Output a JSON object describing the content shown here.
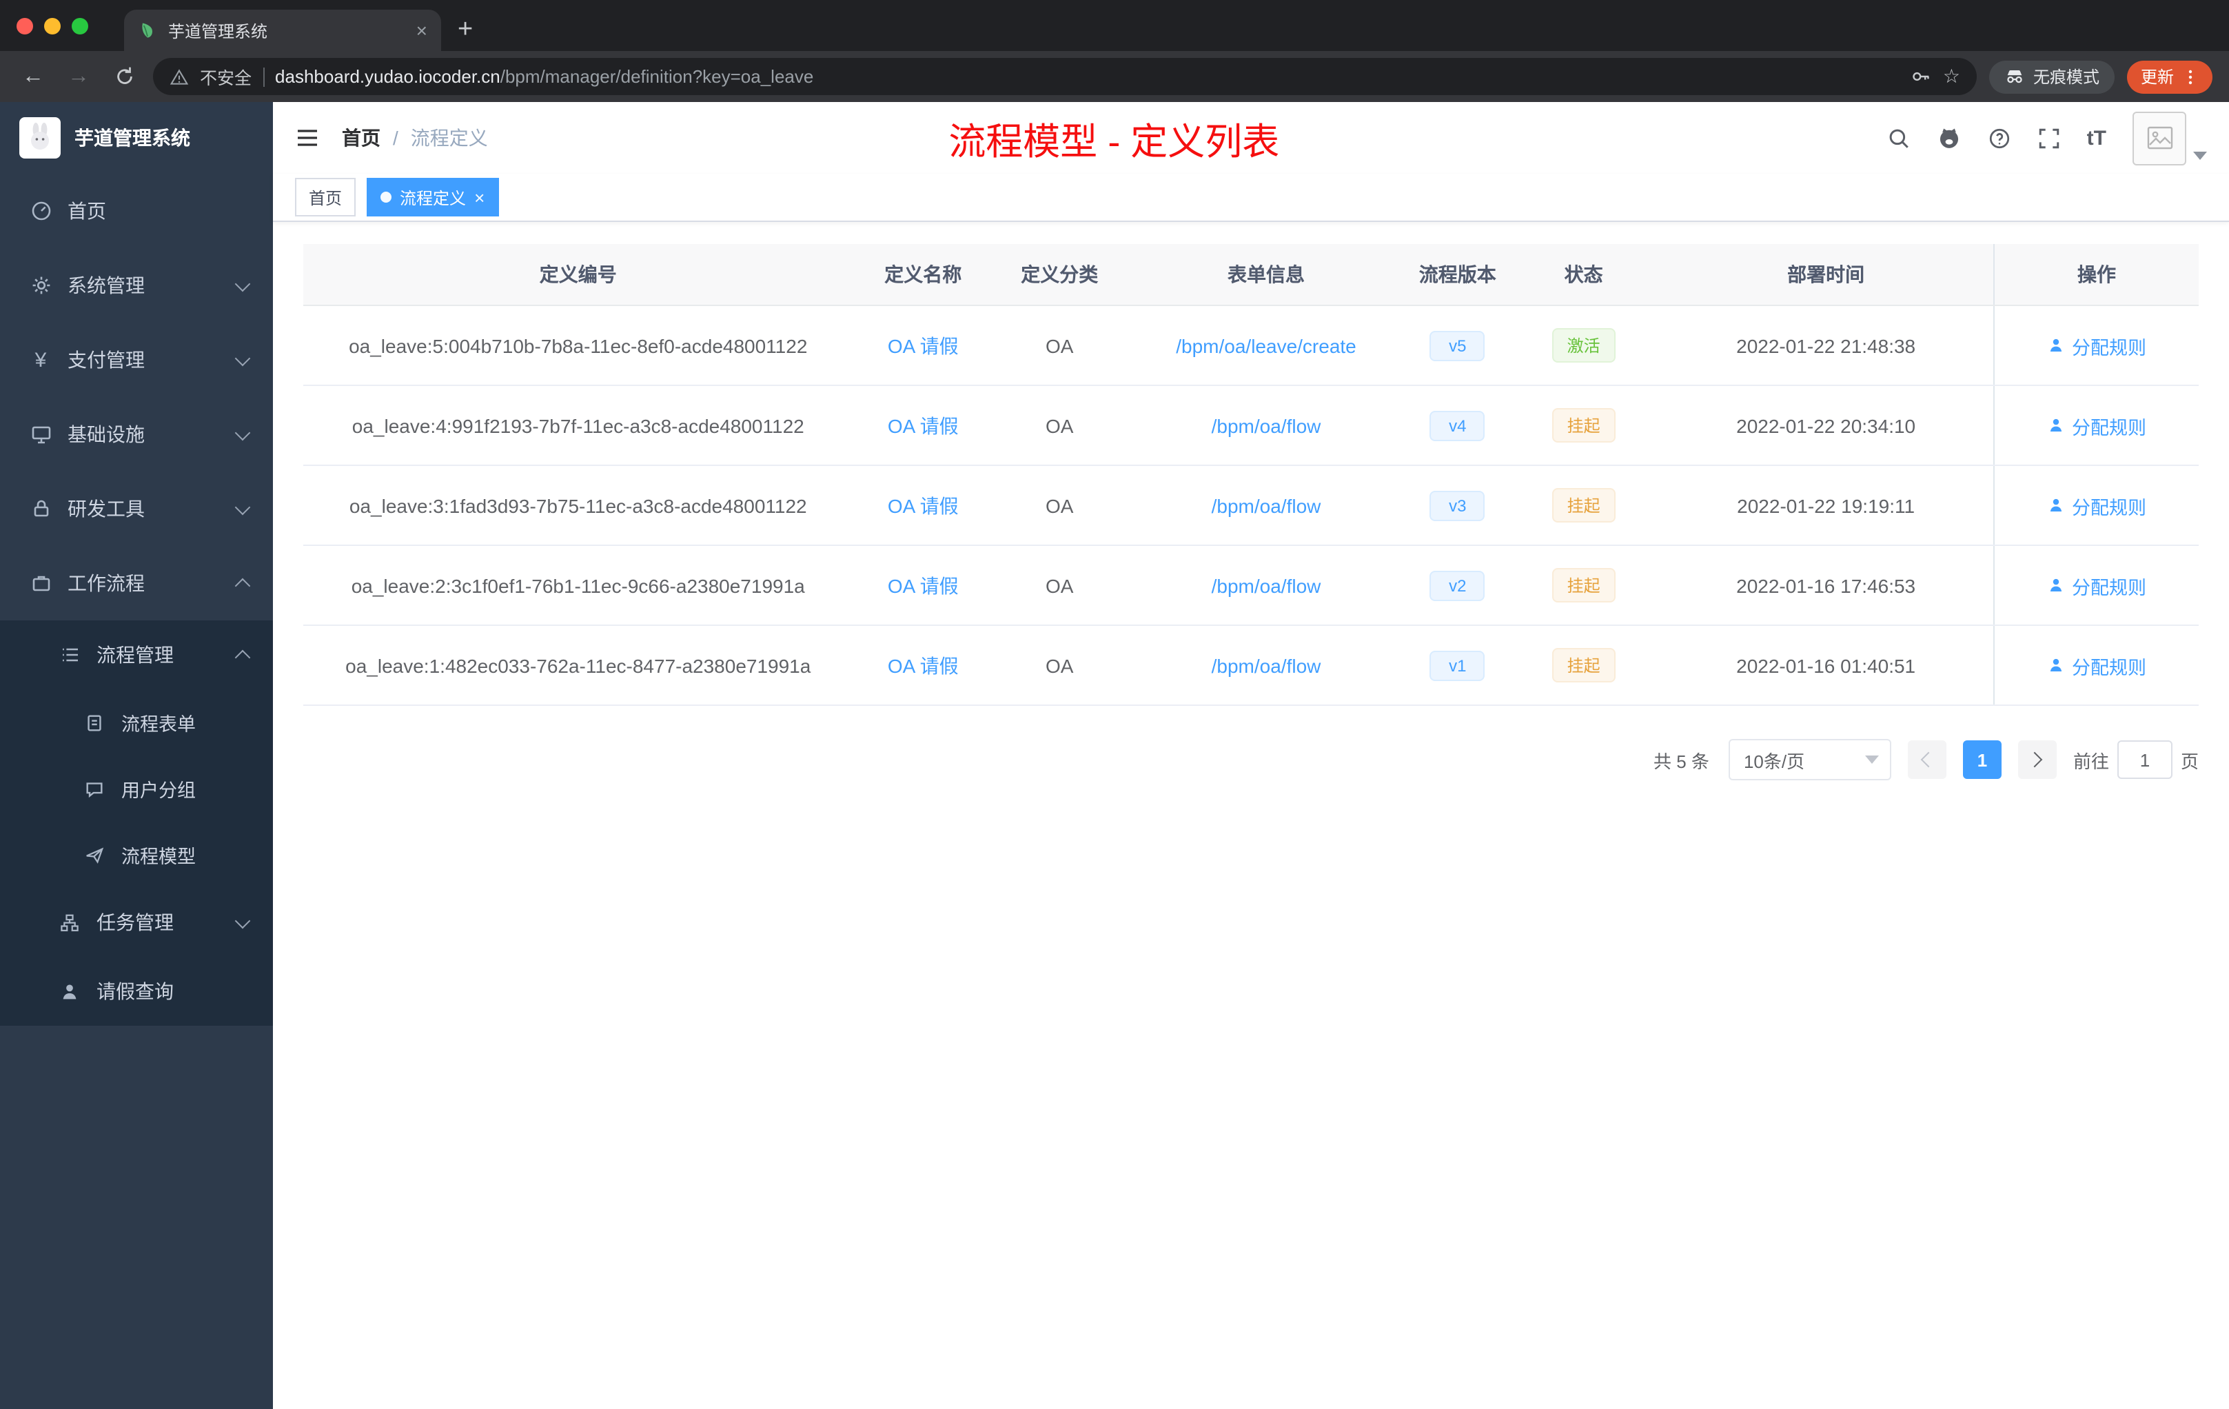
{
  "browser": {
    "tab_title": "芋道管理系统",
    "security_label": "不安全",
    "url_host": "dashboard.yudao.iocoder.cn",
    "url_path": "/bpm/manager/definition?key=oa_leave",
    "incognito_label": "无痕模式",
    "update_label": "更新"
  },
  "sidebar": {
    "logo_title": "芋道管理系统",
    "items": {
      "home": "首页",
      "system": "系统管理",
      "payment": "支付管理",
      "infra": "基础设施",
      "dev_tools": "研发工具",
      "workflow": "工作流程",
      "process_mgmt": "流程管理",
      "process_form": "流程表单",
      "user_group": "用户分组",
      "process_model": "流程模型",
      "task_mgmt": "任务管理",
      "leave_query": "请假查询"
    }
  },
  "header": {
    "breadcrumb_home": "首页",
    "breadcrumb_separator": "/",
    "breadcrumb_current": "流程定义",
    "annotation": "流程模型 - 定义列表",
    "fontsize_glyph": "tT"
  },
  "tags": {
    "home": "首页",
    "active": "流程定义"
  },
  "table": {
    "columns": [
      "定义编号",
      "定义名称",
      "定义分类",
      "表单信息",
      "流程版本",
      "状态",
      "部署时间",
      "操作"
    ],
    "rows": [
      {
        "id": "oa_leave:5:004b710b-7b8a-11ec-8ef0-acde48001122",
        "name": "OA 请假",
        "category": "OA",
        "form": "/bpm/oa/leave/create",
        "version": "v5",
        "status": "激活",
        "status_type": "active",
        "time": "2022-01-22 21:48:38",
        "action": "分配规则"
      },
      {
        "id": "oa_leave:4:991f2193-7b7f-11ec-a3c8-acde48001122",
        "name": "OA 请假",
        "category": "OA",
        "form": "/bpm/oa/flow",
        "version": "v4",
        "status": "挂起",
        "status_type": "suspended",
        "time": "2022-01-22 20:34:10",
        "action": "分配规则"
      },
      {
        "id": "oa_leave:3:1fad3d93-7b75-11ec-a3c8-acde48001122",
        "name": "OA 请假",
        "category": "OA",
        "form": "/bpm/oa/flow",
        "version": "v3",
        "status": "挂起",
        "status_type": "suspended",
        "time": "2022-01-22 19:19:11",
        "action": "分配规则"
      },
      {
        "id": "oa_leave:2:3c1f0ef1-76b1-11ec-9c66-a2380e71991a",
        "name": "OA 请假",
        "category": "OA",
        "form": "/bpm/oa/flow",
        "version": "v2",
        "status": "挂起",
        "status_type": "suspended",
        "time": "2022-01-16 17:46:53",
        "action": "分配规则"
      },
      {
        "id": "oa_leave:1:482ec033-762a-11ec-8477-a2380e71991a",
        "name": "OA 请假",
        "category": "OA",
        "form": "/bpm/oa/flow",
        "version": "v1",
        "status": "挂起",
        "status_type": "suspended",
        "time": "2022-01-16 01:40:51",
        "action": "分配规则"
      }
    ]
  },
  "pagination": {
    "total": "共 5 条",
    "page_size": "10条/页",
    "page": "1",
    "goto_label": "前往",
    "goto_value": "1",
    "unit_label": "页"
  }
}
